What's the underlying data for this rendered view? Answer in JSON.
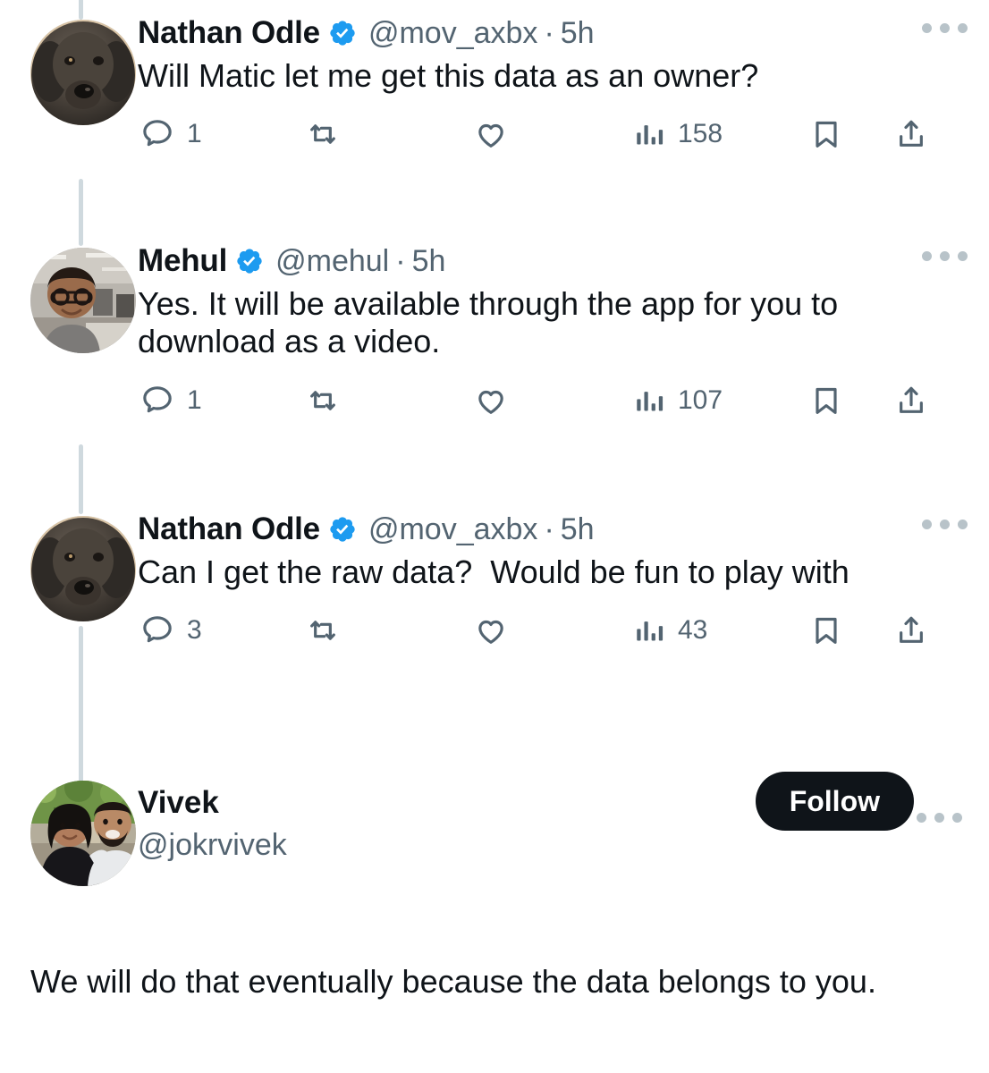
{
  "app": {
    "platform": "X (Twitter)",
    "view": "thread-replies",
    "background": "#ffffff",
    "accent_verified": "#1d9bf0",
    "text_primary": "#0f1419",
    "text_secondary": "#536471",
    "thread_line_color": "#cfd9de"
  },
  "icons": {
    "verified": "verified-badge-icon",
    "reply": "reply-icon",
    "retweet": "retweet-icon",
    "like": "like-heart-icon",
    "views": "views-bar-chart-icon",
    "bookmark": "bookmark-icon",
    "share": "share-icon",
    "more": "more-options-icon"
  },
  "tweets": [
    {
      "id": "tweet-1",
      "author": {
        "name": "Nathan Odle",
        "handle": "@mov_axbx",
        "verified": true,
        "avatar_alt": "dark-shaggy-dog-portrait"
      },
      "timestamp": "5h",
      "separator": "·",
      "text": "Will Matic let me get this data as an owner?",
      "metrics": {
        "replies": "1",
        "retweets": "",
        "likes": "",
        "views": "158"
      }
    },
    {
      "id": "tweet-2",
      "author": {
        "name": "Mehul",
        "handle": "@mehul",
        "verified": true,
        "avatar_alt": "man-with-glasses-in-office"
      },
      "timestamp": "5h",
      "separator": "·",
      "text": "Yes. It will be available through the app for you to download as a video.",
      "metrics": {
        "replies": "1",
        "retweets": "",
        "likes": "",
        "views": "107"
      }
    },
    {
      "id": "tweet-3",
      "author": {
        "name": "Nathan Odle",
        "handle": "@mov_axbx",
        "verified": true,
        "avatar_alt": "dark-shaggy-dog-portrait"
      },
      "timestamp": "5h",
      "separator": "·",
      "text": "Can I get the raw data?  Would be fun to play with",
      "metrics": {
        "replies": "3",
        "retweets": "",
        "likes": "",
        "views": "43"
      }
    }
  ],
  "final_tweet": {
    "id": "tweet-4",
    "author": {
      "name": "Vivek",
      "handle": "@jokrvivek",
      "verified": false,
      "avatar_alt": "couple-outdoors-with-trees"
    },
    "follow_label": "Follow",
    "text": "We will do that eventually because the data belongs to you."
  }
}
